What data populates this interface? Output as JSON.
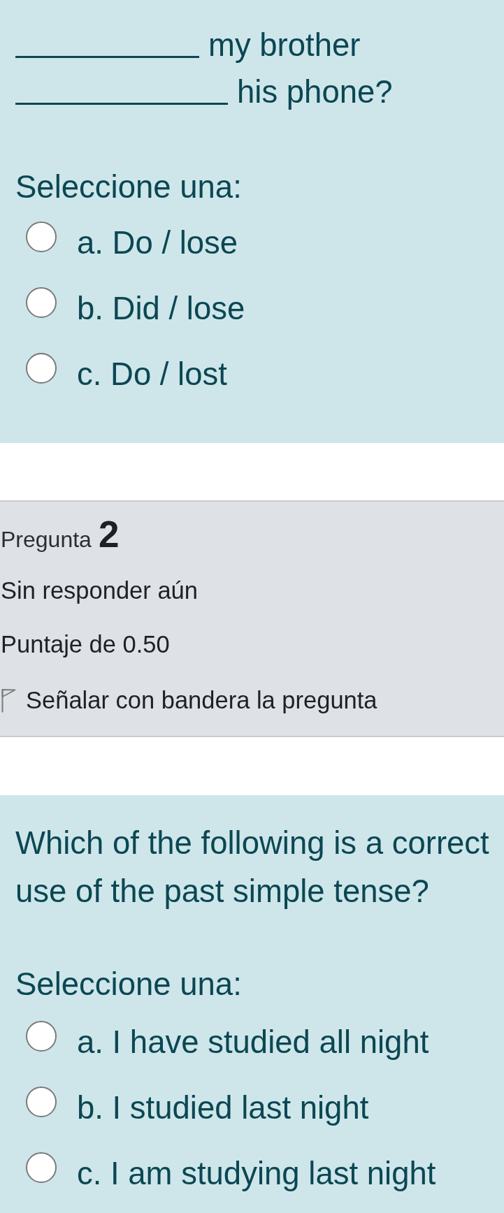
{
  "question_1": {
    "lines": [
      {
        "segments": [
          {
            "kind": "blank"
          },
          {
            "kind": "text",
            "text": "my brother"
          }
        ]
      },
      {
        "segments": [
          {
            "kind": "blank"
          },
          {
            "kind": "text",
            "text": "his phone?"
          }
        ]
      }
    ],
    "prompt": "Seleccione una:",
    "options": [
      {
        "label": "a. Do / lose",
        "selected": false
      },
      {
        "label": "b. Did / lose",
        "selected": false
      },
      {
        "label": "c. Do / lost",
        "selected": false
      }
    ]
  },
  "question_2_info": {
    "label": "Pregunta",
    "number": "2",
    "status": "Sin responder aún",
    "grade": "Puntaje de 0.50",
    "flag_label": "Señalar con bandera la pregunta",
    "flagged": false
  },
  "question_2": {
    "text": "Which of the following is a correct use of the past simple tense?",
    "prompt": "Seleccione una:",
    "options": [
      {
        "label": "a. I have studied all night",
        "selected": false
      },
      {
        "label": "b. I studied last night",
        "selected": false
      },
      {
        "label": "c. I am studying last night",
        "selected": false
      }
    ]
  }
}
